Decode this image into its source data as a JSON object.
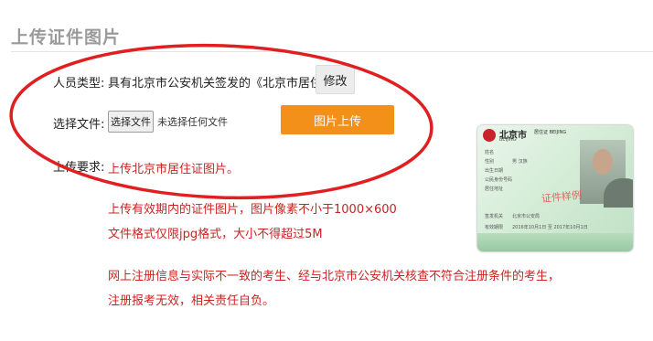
{
  "section": {
    "title": "上传证件图片"
  },
  "form": {
    "type_label": "人员类型:",
    "type_value": "具有北京市公安机关签发的《北京市居住证》",
    "modify_label": "修改",
    "file_label": "选择文件:",
    "choose_file_label": "选择文件",
    "no_file_text": "未选择任何文件",
    "upload_label": "图片上传",
    "requirements_label": "上传要求:",
    "requirements": [
      "上传北京市居住证图片。",
      "上传有效期内的证件图片，图片像素不小于1000×600",
      "文件格式仅限jpg格式，大小不得超过5M",
      "网上注册信息与实际不一致的考生、经与北京市公安机关核查不符合注册条件的考生，",
      "注册报考无效，相关责任自负。"
    ]
  },
  "card": {
    "title_cn": "北京市",
    "title_en": "BEIJING",
    "header": "居住证 BEIJING",
    "watermark": "证件样例",
    "fields": [
      "姓名",
      "性别",
      "出生日期",
      "公民身份号码",
      "居住地址",
      "签发机关",
      "有效期限"
    ],
    "values": [
      "男   汉族",
      "北京市公安局",
      "2016年10月1日 至 2017年10月1日"
    ]
  },
  "colors": {
    "accent": "#f39019",
    "warning": "#cc2222",
    "annotation": "#e02020"
  }
}
